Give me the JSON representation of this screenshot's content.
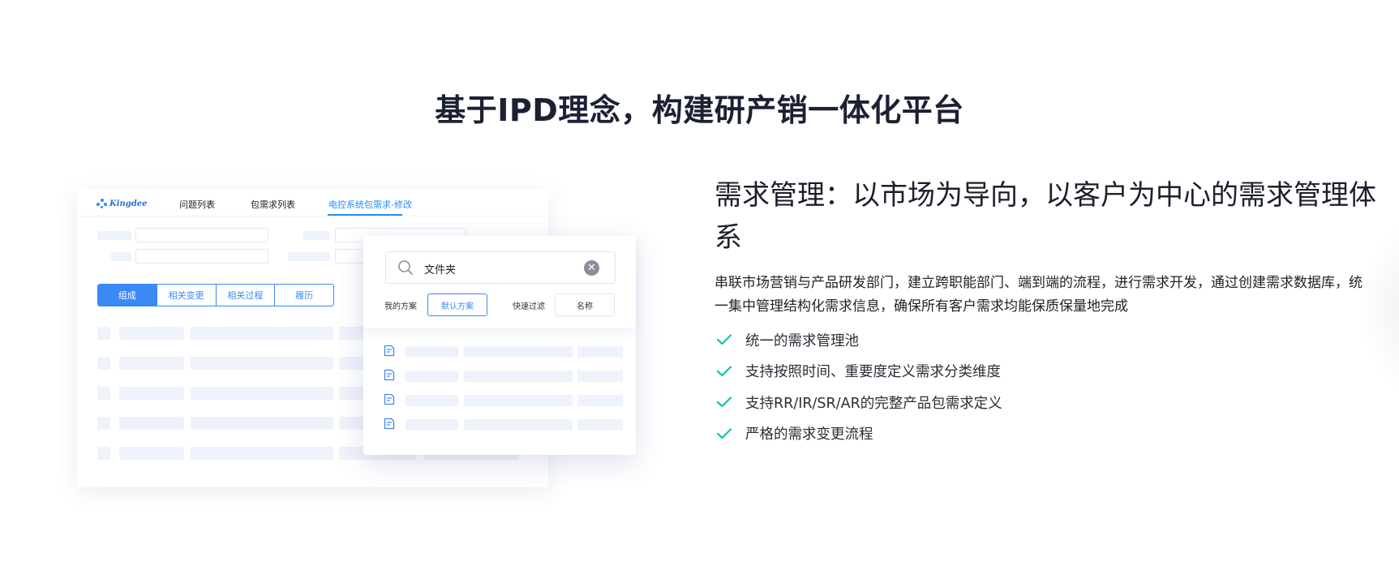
{
  "page": {
    "title": "基于IPD理念，构建研产销一体化平台"
  },
  "mockup": {
    "logo_text": "Kingdee",
    "nav_tabs": [
      {
        "label": "问题列表",
        "active": false
      },
      {
        "label": "包需求列表",
        "active": false
      },
      {
        "label": "电控系统包需求-修改",
        "active": true
      }
    ],
    "segment_tabs": [
      {
        "label": "组成",
        "active": true
      },
      {
        "label": "相关变更",
        "active": false
      },
      {
        "label": "相关过程",
        "active": false
      },
      {
        "label": "履历",
        "active": false
      }
    ],
    "accent": "#3a8af6"
  },
  "popup": {
    "search_value": "文件夹",
    "my_plan_label": "我的方案",
    "default_plan_button": "默认方案",
    "quick_filter_label": "快速过滤",
    "name_button": "名称",
    "icons": {
      "search": "search-icon",
      "clear": "clear-icon",
      "row": "document-icon"
    }
  },
  "section": {
    "heading": "需求管理：以市场为导向，以客户为中心的需求管理体系",
    "description": "串联市场营销与产品研发部门，建立跨职能部门、端到端的流程，进行需求开发，通过创建需求数据库，统一集中管理结构化需求信息，确保所有客户需求均能保质保量地完成",
    "features": [
      "统一的需求管理池",
      "支持按照时间、重要度定义需求分类维度",
      "支持RR/IR/SR/AR的完整产品包需求定义",
      "严格的需求变更流程"
    ],
    "check_color": "#17c3a8"
  }
}
